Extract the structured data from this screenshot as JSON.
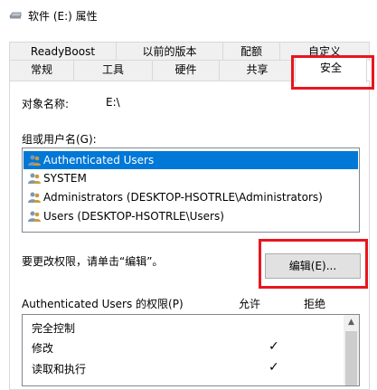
{
  "window": {
    "title": "软件 (E:) 属性"
  },
  "tabs": {
    "back_row": [
      "ReadyBoost",
      "以前的版本",
      "配额",
      "自定义"
    ],
    "front_row": [
      "常规",
      "工具",
      "硬件",
      "共享"
    ],
    "active": "安全"
  },
  "object": {
    "label": "对象名称:",
    "value": "E:\\"
  },
  "group_list": {
    "label": "组或用户名(G):",
    "items": [
      "Authenticated Users",
      "SYSTEM",
      "Administrators (DESKTOP-HSOTRLE\\Administrators)",
      "Users (DESKTOP-HSOTRLE\\Users)"
    ],
    "selected_index": 0
  },
  "change_hint": "要更改权限，请单击“编辑”。",
  "edit_button": "编辑(E)...",
  "permissions": {
    "label": "Authenticated Users 的权限(P)",
    "allow_header": "允许",
    "deny_header": "拒绝",
    "rows": [
      {
        "name": "完全控制",
        "allow": ""
      },
      {
        "name": "修改",
        "allow": "✓"
      },
      {
        "name": "读取和执行",
        "allow": "✓"
      }
    ]
  },
  "colors": {
    "selection": "#0078d7",
    "highlight_box": "#e8161e"
  }
}
